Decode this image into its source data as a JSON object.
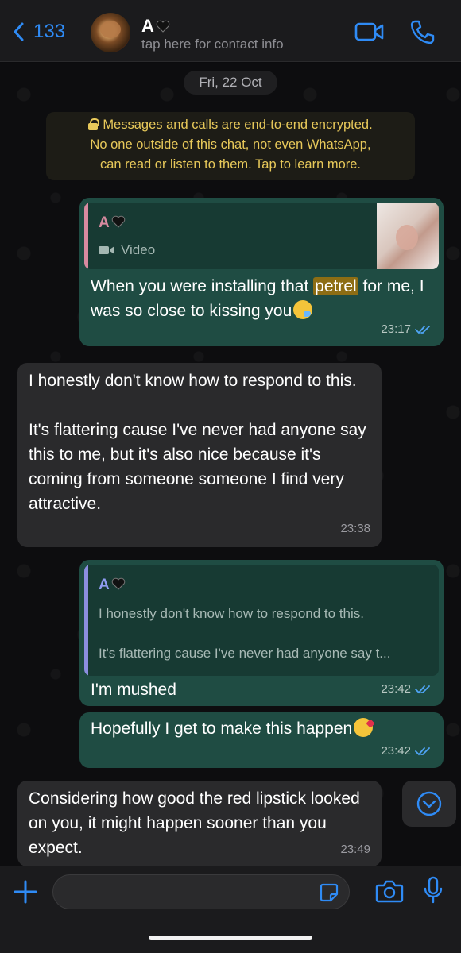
{
  "header": {
    "back_count": "133",
    "contact_name": "A",
    "contact_subtitle": "tap here for contact info"
  },
  "chat": {
    "date_chip": "Fri, 22 Oct",
    "encryption_notice": [
      "Messages and calls are end-to-end encrypted.",
      "No one outside of this chat, not even WhatsApp,",
      "can read or listen to them. Tap to learn more."
    ],
    "messages": [
      {
        "direction": "outgoing",
        "quote_author": "A",
        "quote_type": "Video",
        "text_before": "When you were installing that ",
        "highlight": "petrel",
        "text_after": " for me, I was so close to kissing you",
        "emoji": "tired-face-emoji",
        "time": "23:17"
      },
      {
        "direction": "incoming",
        "paragraph1": "I honestly don't know how to respond to this.",
        "paragraph2": "It's flattering cause I've never had anyone say this to me, but it's also nice because it's coming from someone someone I find very attractive.",
        "time": "23:38"
      },
      {
        "direction": "outgoing",
        "quote_author": "A",
        "quote_line1": "I honestly don't know how to respond to this.",
        "quote_line2": "It's flattering cause I've never had anyone say t...",
        "text": "I'm mushed",
        "time": "23:42"
      },
      {
        "direction": "outgoing",
        "text": "Hopefully I get to make this happen",
        "emoji": "kiss-face-emoji",
        "time": "23:42"
      },
      {
        "direction": "incoming",
        "text": "Considering how good the red lipstick looked on you, it might happen sooner than you expect.",
        "time": "23:49"
      }
    ]
  },
  "colors": {
    "accent": "#2f8bf5",
    "outgoing_bubble": "#1f4c43",
    "incoming_bubble": "#2a2a2c",
    "encryption_text": "#e8c95a"
  }
}
